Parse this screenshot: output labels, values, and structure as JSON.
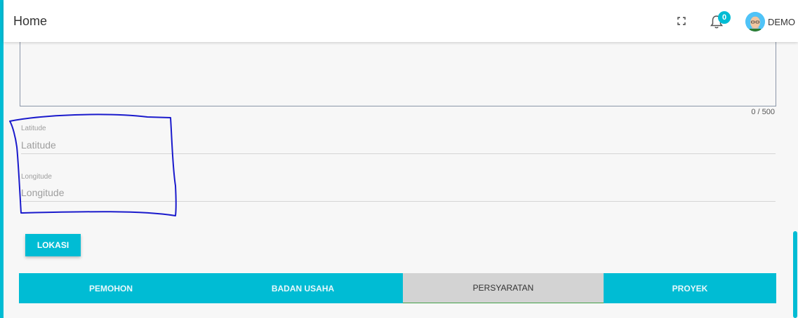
{
  "header": {
    "title": "Home",
    "notification_count": "0",
    "user_name": "DEMO"
  },
  "textarea": {
    "char_count": "0 / 500"
  },
  "fields": {
    "latitude": {
      "label": "Latitude",
      "placeholder": "Latitude",
      "value": ""
    },
    "longitude": {
      "label": "Longitude",
      "placeholder": "Longitude",
      "value": ""
    }
  },
  "buttons": {
    "lokasi": "LOKASI"
  },
  "tabs": [
    {
      "label": "PEMOHON",
      "active": false
    },
    {
      "label": "BADAN USAHA",
      "active": false
    },
    {
      "label": "PERSYARATAN",
      "active": true
    },
    {
      "label": "PROYEK",
      "active": false
    }
  ],
  "colors": {
    "accent": "#00bcd4",
    "active_tab_bg": "#d3d3d3",
    "active_tab_underline": "#43a047",
    "annotation": "#1a1acc"
  },
  "icons": {
    "fullscreen": "fullscreen-icon",
    "bell": "bell-icon",
    "avatar": "avatar"
  }
}
